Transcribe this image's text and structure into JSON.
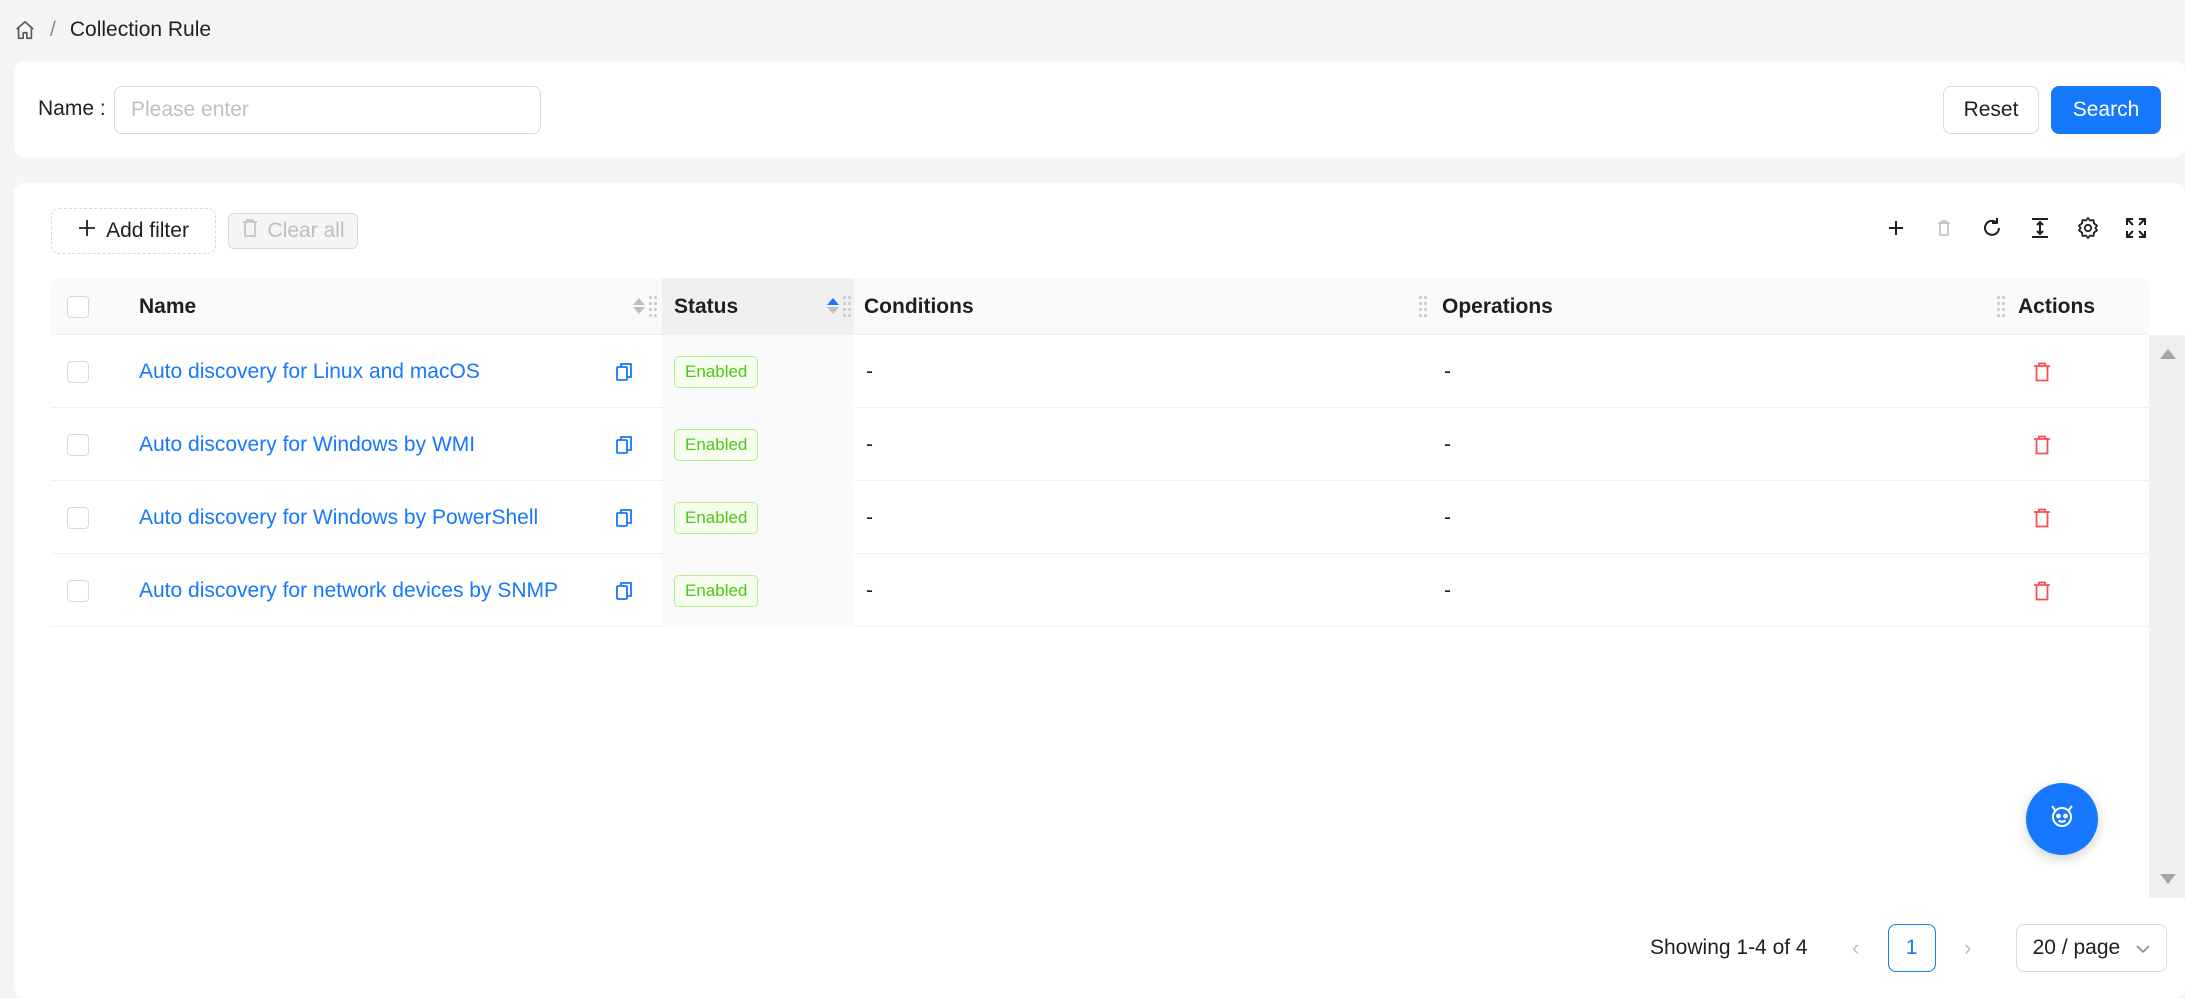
{
  "breadcrumb": {
    "home_icon": "home-icon",
    "separator": "/",
    "current": "Collection Rule"
  },
  "search_form": {
    "name_label": "Name",
    "name_colon": ":",
    "name_placeholder": "Please enter",
    "name_value": "",
    "reset_label": "Reset",
    "search_label": "Search"
  },
  "filters": {
    "add_filter_label": "Add filter",
    "clear_all_label": "Clear all"
  },
  "toolbar": {
    "icons": [
      "plus-icon",
      "delete-icon",
      "reload-icon",
      "column-height-icon",
      "setting-icon",
      "fullscreen-icon"
    ]
  },
  "table": {
    "columns": {
      "name": "Name",
      "status": "Status",
      "conditions": "Conditions",
      "operations": "Operations",
      "actions": "Actions"
    },
    "rows": [
      {
        "name": "Auto discovery for Linux and macOS",
        "status": "Enabled",
        "conditions": "-",
        "operations": "-"
      },
      {
        "name": "Auto discovery for Windows by WMI",
        "status": "Enabled",
        "conditions": "-",
        "operations": "-"
      },
      {
        "name": "Auto discovery for Windows by PowerShell",
        "status": "Enabled",
        "conditions": "-",
        "operations": "-"
      },
      {
        "name": "Auto discovery for network devices by SNMP",
        "status": "Enabled",
        "conditions": "-",
        "operations": "-"
      }
    ]
  },
  "pagination": {
    "summary": "Showing 1-4 of 4",
    "current_page": "1",
    "page_size": "20 / page"
  },
  "colors": {
    "primary": "#1677ff",
    "enabled_tag": "#52c41a",
    "danger": "#ff4d4f"
  }
}
